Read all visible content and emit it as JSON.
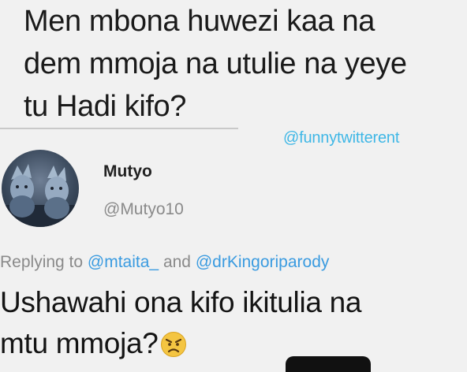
{
  "quoted_tweet": {
    "lines": [
      "Men mbona huwezi kaa na",
      "dem mmoja na utulie na yeye",
      "tu Hadi kifo?"
    ]
  },
  "watermark": "@funnytwitterent",
  "reply_tweet": {
    "display_name": "Mutyo",
    "handle": "@Mutyo10",
    "replying_prefix": "Replying to",
    "replying_connector": "and",
    "mentions": [
      "@mtaita_",
      "@drKingoriparody"
    ],
    "body_lines": [
      "Ushawahi ona kifo ikitulia na",
      "mtu mmoja?"
    ],
    "emoji": "angry-face"
  },
  "colors": {
    "background": "#f1f1f1",
    "mention": "#3a9be0",
    "watermark": "#3fb7e6",
    "secondary_text": "#8a8a8a"
  }
}
